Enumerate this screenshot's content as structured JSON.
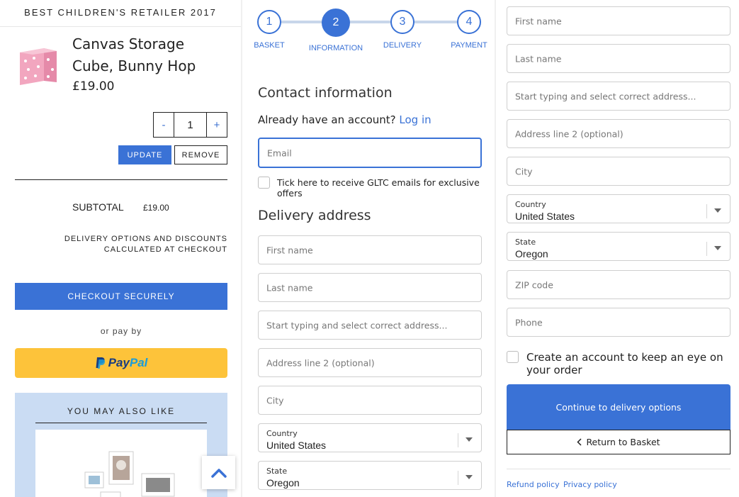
{
  "colors": {
    "accent": "#3a72d6",
    "paypal_yellow": "#fdc33a",
    "recommend_bg": "#cadcf3"
  },
  "basket": {
    "banner": "BEST CHILDREN'S RETAILER 2017",
    "product_name": "Canvas Storage Cube, Bunny Hop",
    "product_price": "£19.00",
    "qty_minus": "-",
    "qty_value": "1",
    "qty_plus": "+",
    "update_label": "UPDATE",
    "remove_label": "REMOVE",
    "subtotal_label": "SUBTOTAL",
    "subtotal_value": "£19.00",
    "delivery_note": "DELIVERY OPTIONS AND DISCOUNTS CALCULATED AT CHECKOUT",
    "checkout_label": "CHECKOUT SECURELY",
    "or_pay_by": "or pay by",
    "paypal_part1": "Pay",
    "paypal_part2": "Pal",
    "also_like_title": "YOU MAY ALSO LIKE",
    "scroll_top_icon": "chevron-up-icon"
  },
  "checkout": {
    "steps": [
      {
        "number": "1",
        "label": "BASKET"
      },
      {
        "number": "2",
        "label": "INFORMATION"
      },
      {
        "number": "3",
        "label": "DELIVERY"
      },
      {
        "number": "4",
        "label": "PAYMENT"
      }
    ],
    "contact_heading": "Contact information",
    "account_prompt": "Already have an account?",
    "login_link": "Log in",
    "email_placeholder": "Email",
    "offers_checkbox_label": "Tick here to receive GLTC emails for exclusive offers",
    "delivery_heading": "Delivery address",
    "fields": {
      "first_name": "First name",
      "last_name": "Last name",
      "address": "Start typing and select correct address...",
      "address2": "Address line 2 (optional)",
      "city": "City",
      "country_label": "Country",
      "country_value": "United States",
      "state_label": "State",
      "state_value": "Oregon",
      "zip": "ZIP code",
      "phone": "Phone"
    },
    "create_account_label": "Create an account to keep an eye on your order",
    "continue_label": "Continue to delivery options",
    "return_label": "Return to Basket",
    "refund_policy": "Refund policy",
    "privacy_policy": "Privacy policy"
  }
}
